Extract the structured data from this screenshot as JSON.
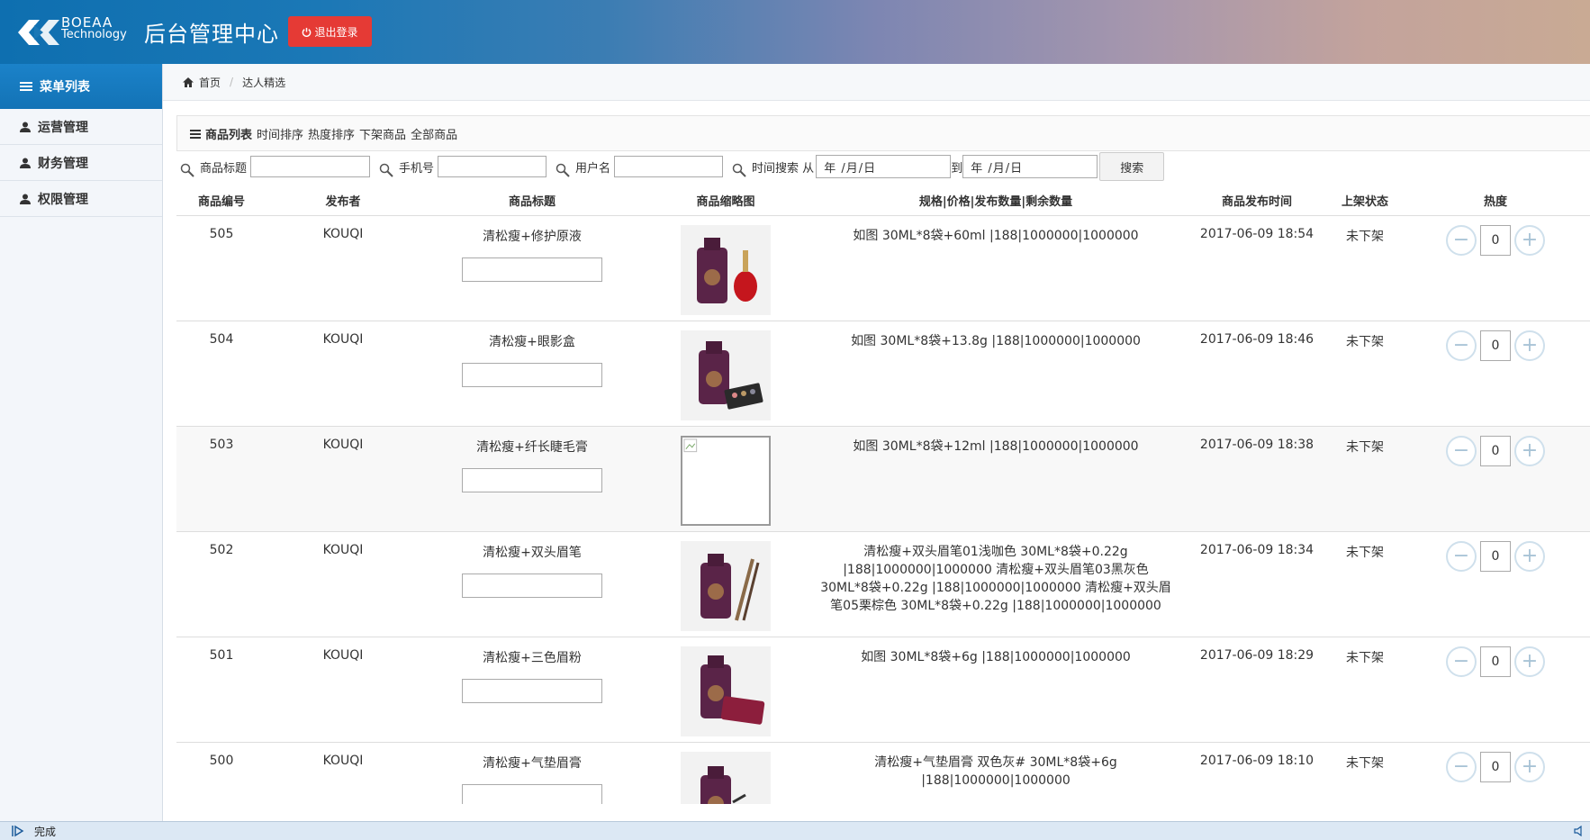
{
  "header": {
    "logo_line1": "BOEAA",
    "logo_line2": "Technology",
    "title": "后台管理中心",
    "logout_label": "退出登录"
  },
  "sidebar": {
    "heading": "菜单列表",
    "items": [
      {
        "label": "运营管理"
      },
      {
        "label": "财务管理"
      },
      {
        "label": "权限管理"
      }
    ]
  },
  "breadcrumb": {
    "home": "首页",
    "current": "达人精选"
  },
  "panel": {
    "title": "商品列表",
    "links": [
      "时间排序",
      "热度排序",
      "下架商品",
      "全部商品"
    ]
  },
  "filters": {
    "title_label": "商品标题",
    "phone_label": "手机号",
    "user_label": "用户名",
    "time_label": "时间搜索 从",
    "from_date": "年 /月/日",
    "to_label": "到",
    "to_date": "年 /月/日",
    "search_label": "搜索"
  },
  "table": {
    "columns": [
      "商品编号",
      "发布者",
      "商品标题",
      "商品缩略图",
      "规格|价格|发布数量|剩余数量",
      "商品发布时间",
      "上架状态",
      "热度"
    ],
    "rows": [
      {
        "id": "505",
        "publisher": "KOUQI",
        "title": "清松瘦+修护原液",
        "spec": "如图 30ML*8袋+60ml |188|1000000|1000000",
        "time": "2017-06-09 18:54",
        "status": "未下架",
        "heat": "0"
      },
      {
        "id": "504",
        "publisher": "KOUQI",
        "title": "清松瘦+眼影盒",
        "spec": "如图 30ML*8袋+13.8g |188|1000000|1000000",
        "time": "2017-06-09 18:46",
        "status": "未下架",
        "heat": "0"
      },
      {
        "id": "503",
        "publisher": "KOUQI",
        "title": "清松瘦+纤长睫毛膏",
        "spec": "如图 30ML*8袋+12ml |188|1000000|1000000",
        "time": "2017-06-09 18:38",
        "status": "未下架",
        "heat": "0"
      },
      {
        "id": "502",
        "publisher": "KOUQI",
        "title": "清松瘦+双头眉笔",
        "spec": "清松瘦+双头眉笔01浅咖色 30ML*8袋+0.22g |188|1000000|1000000 清松瘦+双头眉笔03黑灰色 30ML*8袋+0.22g |188|1000000|1000000 清松瘦+双头眉笔05栗棕色 30ML*8袋+0.22g |188|1000000|1000000",
        "time": "2017-06-09 18:34",
        "status": "未下架",
        "heat": "0"
      },
      {
        "id": "501",
        "publisher": "KOUQI",
        "title": "清松瘦+三色眉粉",
        "spec": "如图 30ML*8袋+6g |188|1000000|1000000",
        "time": "2017-06-09 18:29",
        "status": "未下架",
        "heat": "0"
      },
      {
        "id": "500",
        "publisher": "KOUQI",
        "title": "清松瘦+气垫眉膏",
        "spec": "清松瘦+气垫眉膏 双色灰# 30ML*8袋+6g |188|1000000|1000000",
        "time": "2017-06-09 18:10",
        "status": "未下架",
        "heat": "0"
      }
    ]
  },
  "statusbar": {
    "text": "完成"
  },
  "colors": {
    "accent": "#1b82c9",
    "logout": "#e53a35"
  }
}
